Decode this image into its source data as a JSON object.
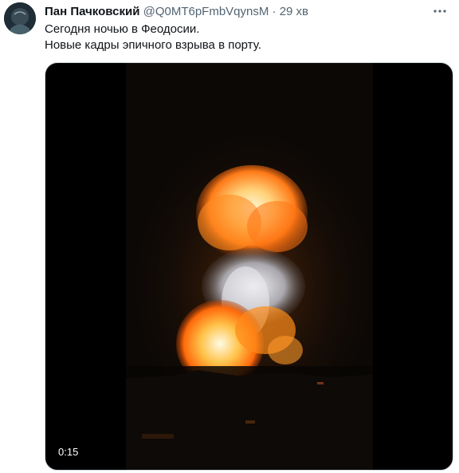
{
  "tweet": {
    "author_name": "Пан Пачковский",
    "handle": "@Q0MT6pFmbVqynsM",
    "separator": "·",
    "time": "29 хв",
    "more_icon": "more-horizontal-icon",
    "text_lines": [
      "Сегодня ночью в Феодосии.",
      "Новые кадры эпичного взрыва в порту."
    ],
    "video": {
      "duration": "0:15"
    }
  },
  "colors": {
    "border": "#cfd9de",
    "secondary_text": "#536471",
    "primary_text": "#0f1419"
  }
}
